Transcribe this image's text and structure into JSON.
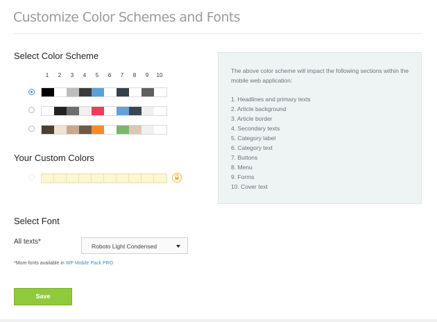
{
  "page": {
    "title": "Customize Color Schemes and Fonts"
  },
  "scheme": {
    "heading": "Select Color Scheme",
    "column_numbers": [
      "1",
      "2",
      "3",
      "4",
      "5",
      "6",
      "7",
      "8",
      "9",
      "10"
    ],
    "selected": 0,
    "rows": [
      [
        "#000000",
        "#ffffff",
        "#bdbdbd",
        "#3a3a3a",
        "#5b9fd8",
        "#ffffff",
        "#36414c",
        "#ffffff",
        "#5f5f5f",
        "#ffffff"
      ],
      [
        "#ffffff",
        "#222222",
        "#6d6d6d",
        "#f0f0f0",
        "#f23a5a",
        "#ffffff",
        "#5ea2dc",
        "#3a4552",
        "#f0f0f0",
        "#ffffff"
      ],
      [
        "#4f3e31",
        "#f1e2d2",
        "#c6a98c",
        "#6d5a4b",
        "#f38b2b",
        "#ffffff",
        "#78b768",
        "#dcc7b1",
        "#f0f0f0",
        "#ffffff"
      ]
    ]
  },
  "custom": {
    "heading": "Your Custom Colors",
    "lock_icon": "lock-icon"
  },
  "info": {
    "intro": "The above color scheme will impact the following sections within the mobile web application:",
    "items": [
      "1. Headlines and primary texts",
      "2. Article background",
      "3. Article border",
      "4. Secondary texts",
      "5. Category label",
      "6. Category text",
      "7. Buttons",
      "8. Menu",
      "9. Forms",
      "10. Cover text"
    ]
  },
  "font": {
    "heading": "Select Font",
    "label": "All texts*",
    "selected": "Roboto Light Condensed",
    "note_prefix": "*More fonts available in ",
    "note_link": "WP Mobile Pack PRO"
  },
  "save_label": "Save"
}
